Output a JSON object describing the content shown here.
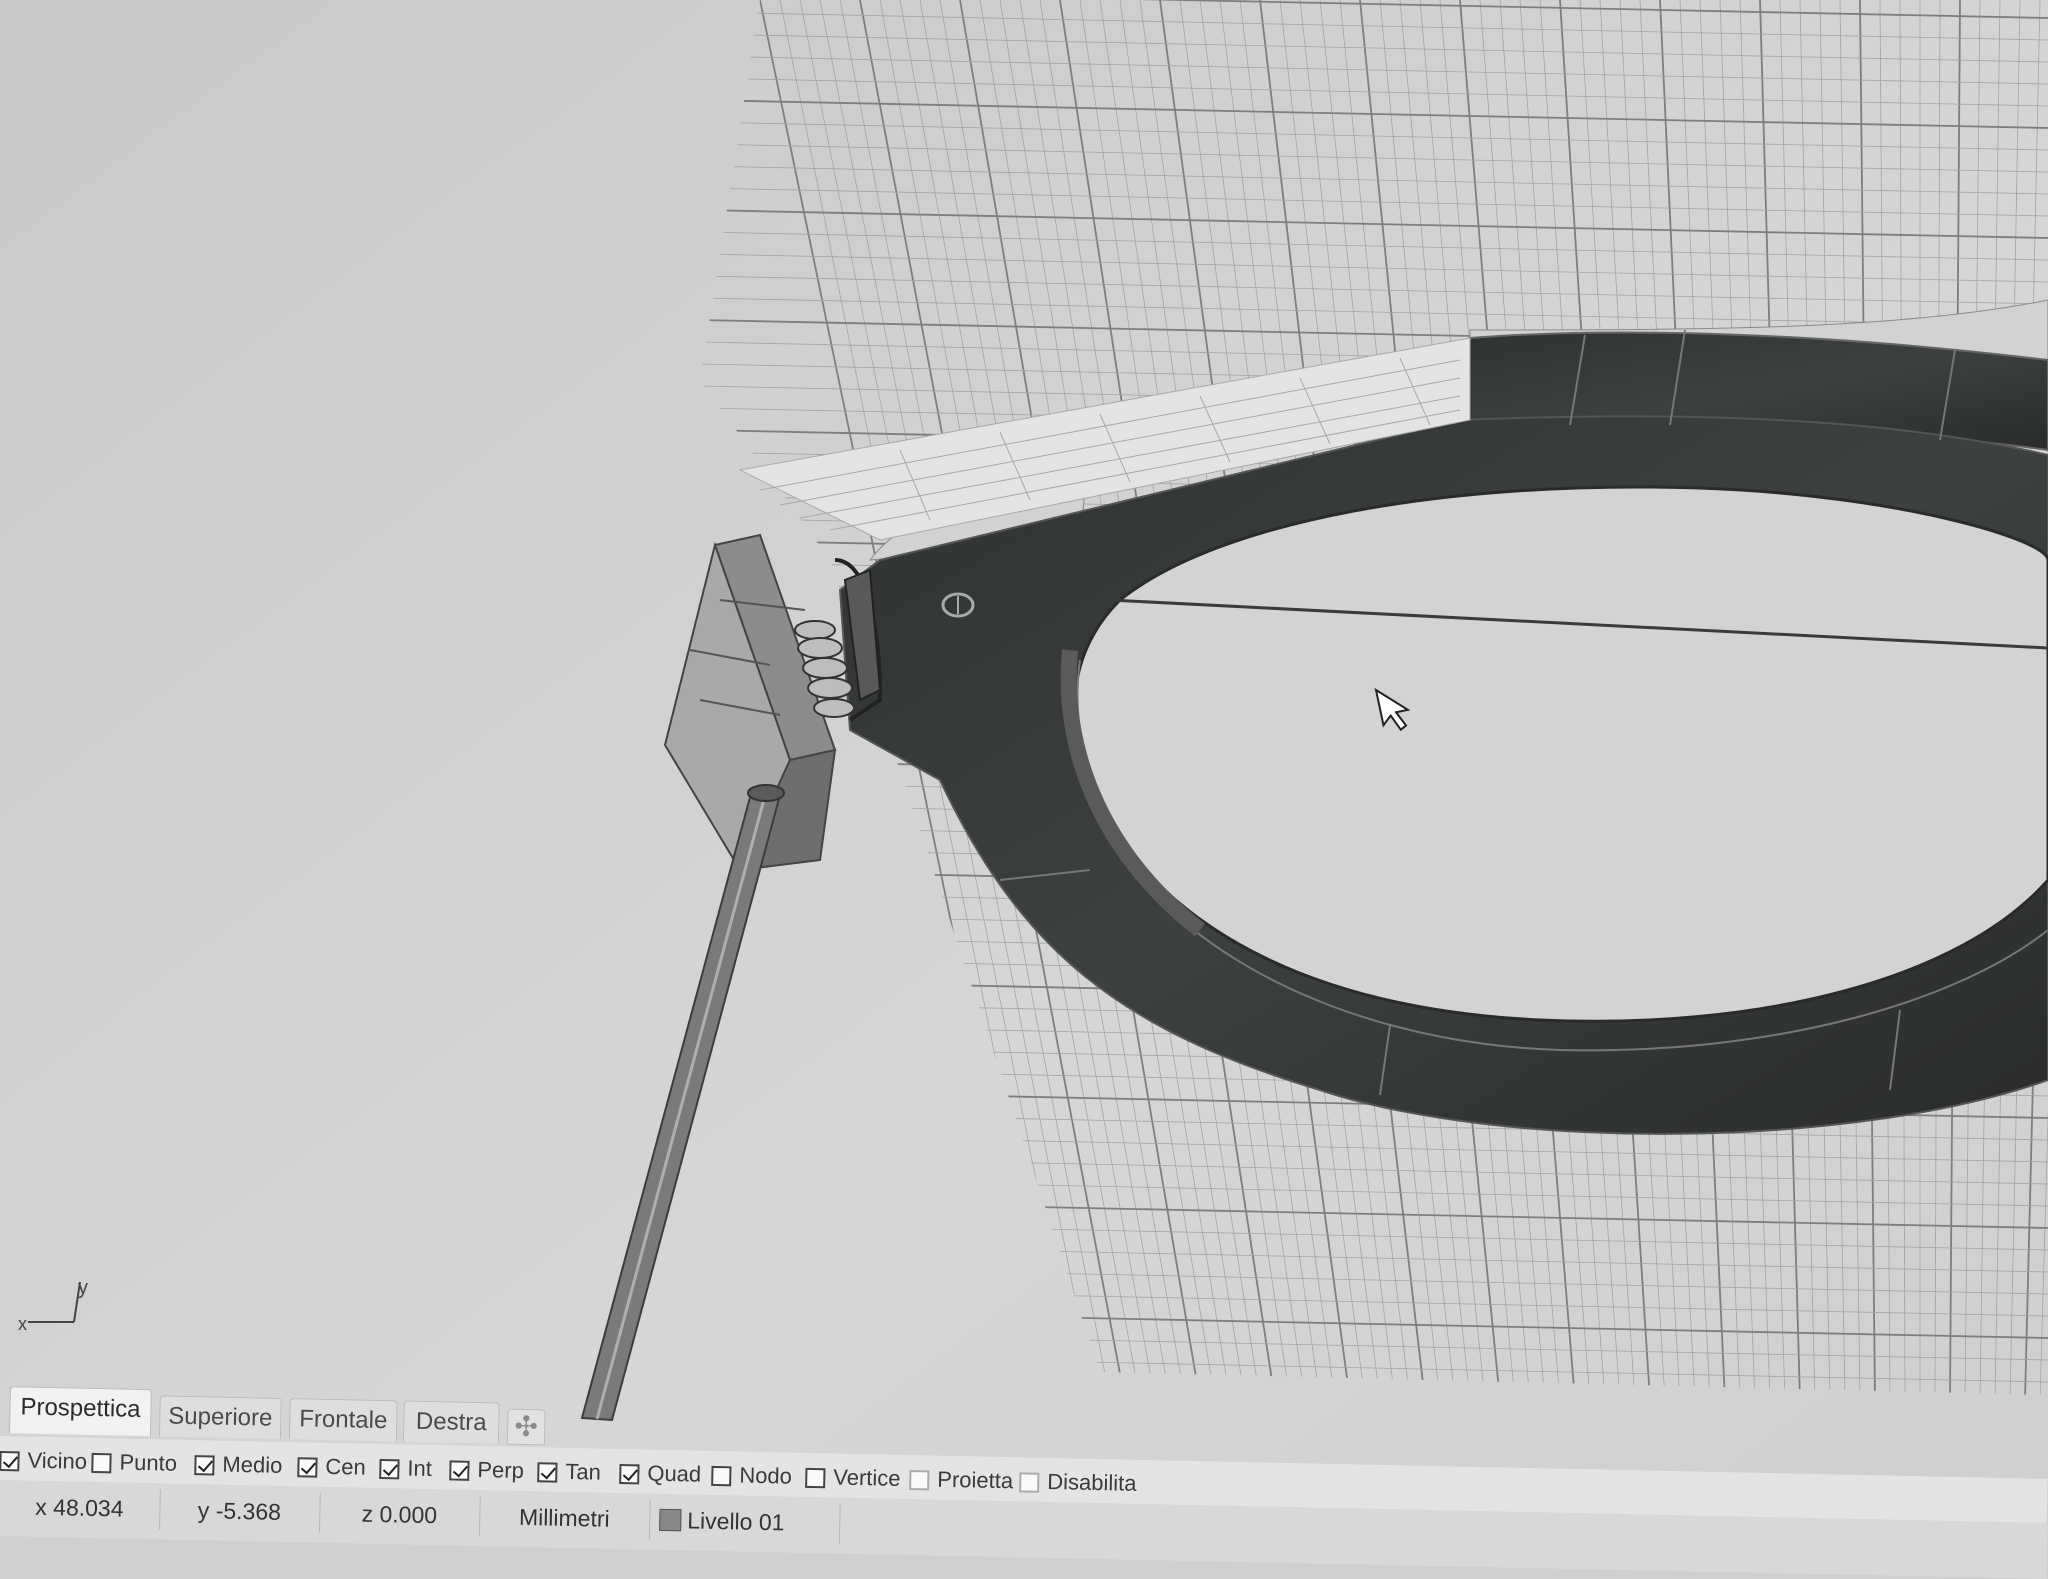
{
  "viewport_tabs": [
    {
      "label": "Prospettica",
      "active": true
    },
    {
      "label": "Superiore",
      "active": false
    },
    {
      "label": "Frontale",
      "active": false
    },
    {
      "label": "Destra",
      "active": false
    }
  ],
  "add_tab_icon": "plus-icon",
  "snaps": [
    {
      "label": "Vicino",
      "checked": true
    },
    {
      "label": "Punto",
      "checked": false
    },
    {
      "label": "Medio",
      "checked": true
    },
    {
      "label": "Cen",
      "checked": true
    },
    {
      "label": "Int",
      "checked": true
    },
    {
      "label": "Perp",
      "checked": true
    },
    {
      "label": "Tan",
      "checked": true
    },
    {
      "label": "Quad",
      "checked": true
    },
    {
      "label": "Nodo",
      "checked": false
    },
    {
      "label": "Vertice",
      "checked": false
    },
    {
      "label": "Proietta",
      "checked": false
    },
    {
      "label": "Disabilita",
      "checked": false
    }
  ],
  "status": {
    "x": "x 48.034",
    "y": "y -5.368",
    "z": "z 0.000",
    "units": "Millimetri",
    "layer": "Livello 01"
  },
  "axis_icon": {
    "x_label": "x",
    "y_label": "y"
  },
  "colors": {
    "viewport_bg": "#cfcfcf",
    "grid_line": "#9a9a9a",
    "model_dark": "#3a3d3d"
  }
}
